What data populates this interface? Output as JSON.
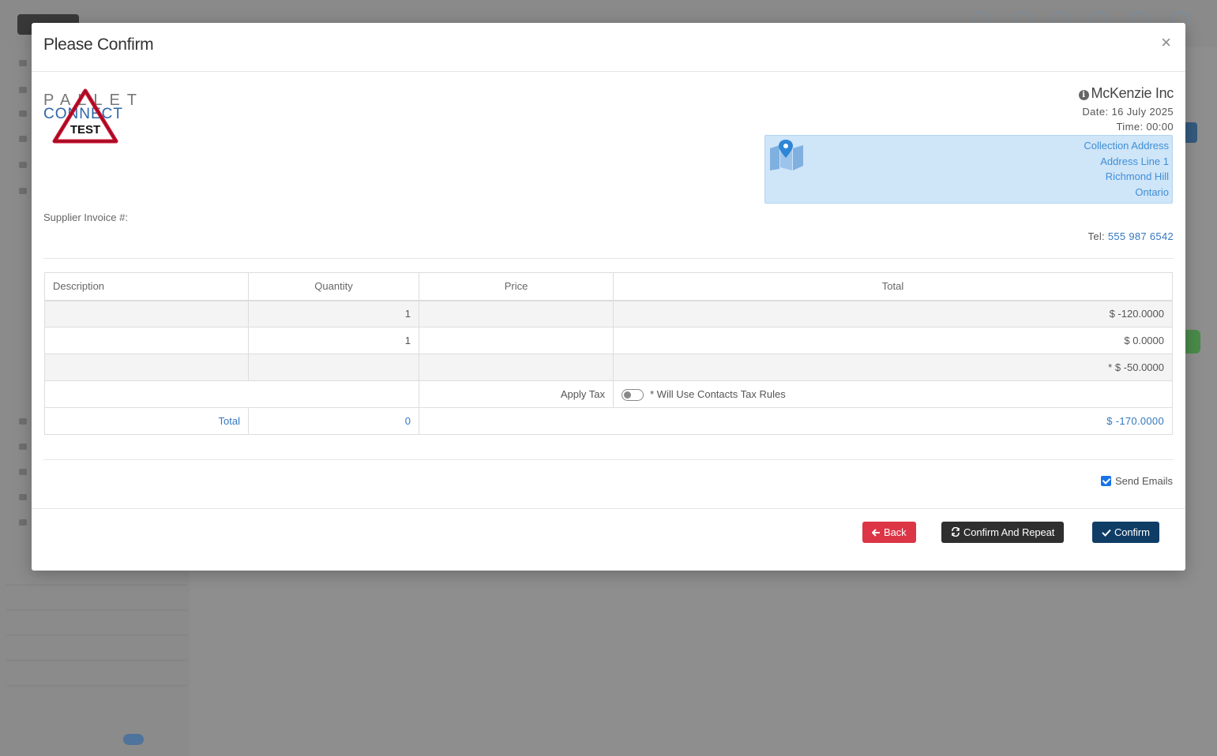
{
  "modal": {
    "title": "Please Confirm",
    "close_glyph": "×"
  },
  "logo": {
    "line1": "PALLET",
    "line2": "CONNECT",
    "badge": "TEST"
  },
  "supplier_invoice_label": "Supplier Invoice #:",
  "company": {
    "name": "McKenzie Inc",
    "date": "Date: 16 July 2025",
    "time": "Time: 00:00"
  },
  "address": {
    "lines": [
      "Collection Address",
      "Address Line 1",
      "Richmond Hill",
      "Ontario"
    ]
  },
  "tel": {
    "label": "Tel:",
    "number": "555 987 6542"
  },
  "table": {
    "headers": {
      "description": "Description",
      "quantity": "Quantity",
      "price": "Price",
      "total": "Total"
    },
    "rows": [
      {
        "description": "",
        "quantity": "1",
        "price": "",
        "total": "$ -120.0000"
      },
      {
        "description": "",
        "quantity": "1",
        "price": "",
        "total": "$ 0.0000"
      },
      {
        "description": "",
        "quantity": "",
        "price": "",
        "total": "* $ -50.0000"
      }
    ],
    "apply_tax_label": "Apply Tax",
    "tax_note": "* Will Use Contacts Tax Rules",
    "total_label": "Total",
    "total_quantity": "0",
    "total_amount": "$ -170.0000"
  },
  "send_emails": {
    "label": "Send Emails",
    "checked": true
  },
  "buttons": {
    "back": "Back",
    "confirm_repeat": "Confirm And Repeat",
    "confirm": "Confirm"
  },
  "colors": {
    "danger": "#dc3545",
    "dark": "#2f2f2f",
    "primary": "#0f3d66",
    "link": "#3478c0",
    "address_bg": "#cfe5f8"
  }
}
